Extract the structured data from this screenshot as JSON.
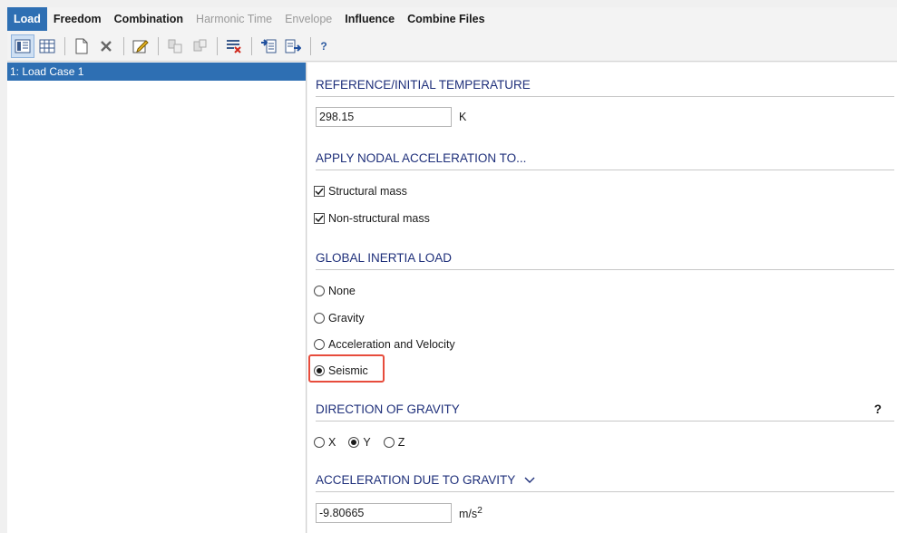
{
  "tabs": [
    {
      "label": "Load",
      "state": "active"
    },
    {
      "label": "Freedom",
      "state": "normal"
    },
    {
      "label": "Combination",
      "state": "normal"
    },
    {
      "label": "Harmonic Time",
      "state": "disabled"
    },
    {
      "label": "Envelope",
      "state": "disabled"
    },
    {
      "label": "Influence",
      "state": "normal"
    },
    {
      "label": "Combine Files",
      "state": "normal"
    }
  ],
  "toolbar": {
    "help_label": "?"
  },
  "load_cases": [
    "1: Load Case 1"
  ],
  "reference_temperature": {
    "title": "REFERENCE/INITIAL TEMPERATURE",
    "value": "298.15",
    "unit": "K"
  },
  "nodal_acceleration": {
    "title": "APPLY NODAL ACCELERATION TO...",
    "options": [
      {
        "label": "Structural mass",
        "checked": true
      },
      {
        "label": "Non-structural mass",
        "checked": true
      }
    ]
  },
  "global_inertia": {
    "title": "GLOBAL INERTIA LOAD",
    "options": [
      "None",
      "Gravity",
      "Acceleration and Velocity",
      "Seismic"
    ],
    "selected": "Seismic"
  },
  "gravity_direction": {
    "title": "DIRECTION OF GRAVITY",
    "help_label": "?",
    "options": [
      "X",
      "Y",
      "Z"
    ],
    "selected": "Y"
  },
  "gravity_acceleration": {
    "title": "ACCELERATION DUE TO GRAVITY",
    "value": "-9.80665",
    "unit": "m/s",
    "unit_exponent": "2"
  },
  "colors": {
    "accent": "#2e6fb3",
    "section_title": "#1e2f7a",
    "highlight": "#e74c3c"
  }
}
